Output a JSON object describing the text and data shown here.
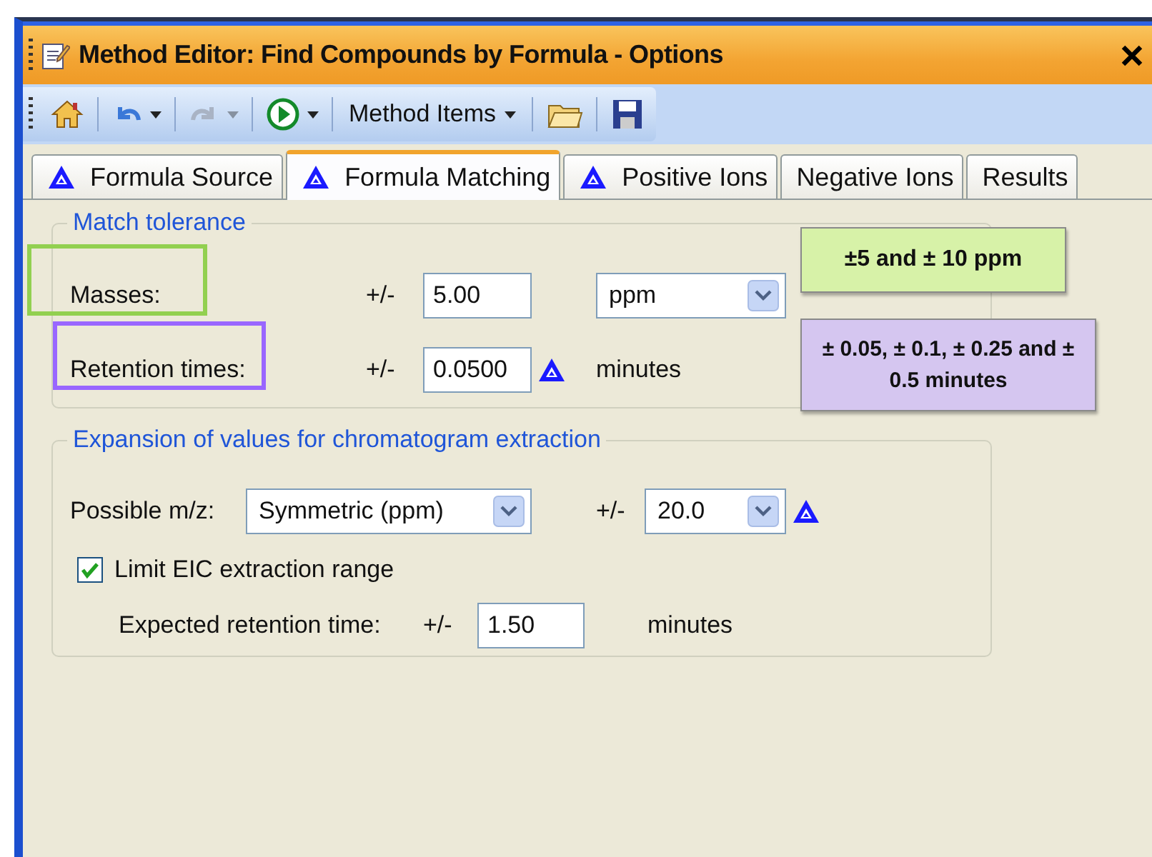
{
  "window": {
    "title": "Method Editor: Find Compounds by Formula - Options"
  },
  "toolbar": {
    "items": [
      {
        "kind": "home"
      },
      {
        "kind": "undo",
        "disabled": false
      },
      {
        "kind": "redo",
        "disabled": true
      },
      {
        "kind": "run",
        "disabled": false
      },
      {
        "kind": "menu",
        "label": "Method Items",
        "disabled": false
      },
      {
        "kind": "open"
      },
      {
        "kind": "save"
      }
    ]
  },
  "tabs": [
    {
      "label": "Formula Source",
      "selected": false,
      "flagged": true
    },
    {
      "label": "Formula Matching",
      "selected": true,
      "flagged": true
    },
    {
      "label": "Positive Ions",
      "selected": false,
      "flagged": true
    },
    {
      "label": "Negative Ions",
      "selected": false,
      "flagged": false
    },
    {
      "label": "Results",
      "selected": false,
      "flagged": false
    }
  ],
  "match_tolerance": {
    "title": "Match tolerance",
    "rows": [
      {
        "label": "Masses:",
        "prefix": "+/-",
        "value": "5.00",
        "unit_select": "ppm",
        "flagged": false,
        "color": "#92d050"
      },
      {
        "label": "Retention times:",
        "prefix": "+/-",
        "value": "0.0500",
        "unit": "minutes",
        "flagged": true,
        "color": "#9966ff"
      }
    ]
  },
  "expansion": {
    "title": "Expansion of values for chromatogram extraction",
    "possible_mz": {
      "label": "Possible m/z:",
      "mode": "Symmetric (ppm)",
      "prefix": "+/-",
      "value": "20.0",
      "flagged": true
    },
    "limit": {
      "label": "Limit EIC extraction range",
      "checked": true
    },
    "expected": {
      "label": "Expected retention time:",
      "prefix": "+/-",
      "value": "1.50",
      "unit": "minutes"
    }
  },
  "callouts": [
    {
      "text": "±5 and ± 10 ppm",
      "color": "#d7f2a8"
    },
    {
      "text": "± 0.05, ± 0.1, ± 0.25 and ± 0.5 minutes",
      "color": "#d5c6f0"
    }
  ]
}
